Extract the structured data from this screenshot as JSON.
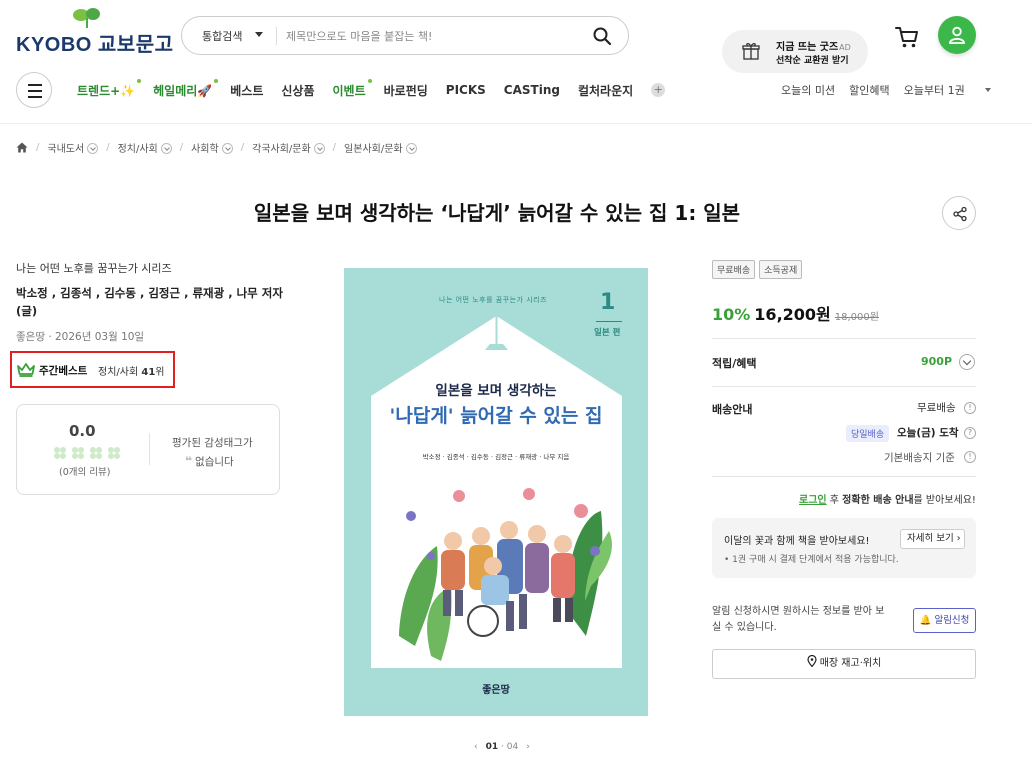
{
  "header": {
    "logo": "KYOBO 교보문고",
    "search_type": "통합검색",
    "search_placeholder": "제목만으로도 마음을 붙잡는 책!",
    "promo_line1": "지금 뜨는 굿즈",
    "promo_ad": "AD",
    "promo_line2": "선착순 교환권 받기"
  },
  "nav": {
    "items": [
      {
        "label": "트렌드+✨",
        "green": true,
        "dot": true
      },
      {
        "label": "헤일메리🚀",
        "green": true,
        "dot": true
      },
      {
        "label": "베스트",
        "green": false
      },
      {
        "label": "신상품",
        "green": false
      },
      {
        "label": "이벤트",
        "green": true,
        "dot": true
      },
      {
        "label": "바로펀딩",
        "green": false
      },
      {
        "label": "PICKS",
        "green": false
      },
      {
        "label": "CASTing",
        "green": false
      },
      {
        "label": "컬처라운지",
        "green": false
      }
    ],
    "plus": "+",
    "right": [
      "오늘의 미션",
      "할인혜택",
      "오늘부터 1권"
    ]
  },
  "breadcrumb": [
    "국내도서",
    "정치/사회",
    "사회학",
    "각국사회/문화",
    "일본사회/문화"
  ],
  "product": {
    "title": "일본을 보며 생각하는 ‘나답게’ 늙어갈 수 있는 집 1: 일본",
    "series": "나는 어떤 노후를 꿈꾸는가 시리즈",
    "authors": "박소정 , 김종석 , 김수동 , 김정근 , 류재광 , 나무 저자(글)",
    "publisher_date": "좋은땅 · 2026년 03월 10일",
    "bestseller_label": "주간베스트",
    "bestseller_category": "정치/사회",
    "bestseller_rank": "41",
    "bestseller_rank_suffix": "위",
    "rating": "0.0",
    "review_count": "(0개의 리뷰)",
    "emotion_tag_line1": "평가된 감성태그가",
    "emotion_tag_line2": "없습니다"
  },
  "cover": {
    "series": "나는 어떤 노후를 꿈꾸는가 시리즈",
    "vol": "1",
    "vol_sub": "일본 편",
    "title1": "일본을 보며 생각하는",
    "title2": "'나답게' 늙어갈 수 있는 집",
    "authors": "박소정 · 김종석 · 김수동 · 김정근 · 류재광 · 나무 지음",
    "publisher": "좋은땅"
  },
  "pager": {
    "current": "01",
    "total": "04"
  },
  "purchase": {
    "badges": [
      "무료배송",
      "소득공제"
    ],
    "discount": "10%",
    "price": "16,200원",
    "original_price": "18,000원",
    "points_label": "적립/혜택",
    "points": "900P",
    "shipping_label": "배송안내",
    "shipping_free": "무료배송",
    "same_day": "당일배송",
    "arrival": "오늘(금) 도착",
    "base_address": "기본배송지 기준",
    "login_link": "로그인",
    "login_mid": " 후 ",
    "login_bold": "정확한 배송 안내",
    "login_tail": "를 받아보세요!",
    "flower_title": "이달의 꽃과 함께 책을 받아보세요!",
    "flower_sub": "• 1권 구매 시 결제 단계에서 적용 가능합니다.",
    "flower_btn": "자세히 보기",
    "alarm_text": "알림 신청하시면 원하시는 정보를 받아 보실 수 있습니다.",
    "alarm_btn": "알림신청",
    "store_btn": "매장 재고·위치"
  },
  "colors": {
    "brand_green": "#3aa13a",
    "logo_blue": "#1b3a6b",
    "highlight_red": "#e02020",
    "cover_mint": "#a8dcd7"
  }
}
